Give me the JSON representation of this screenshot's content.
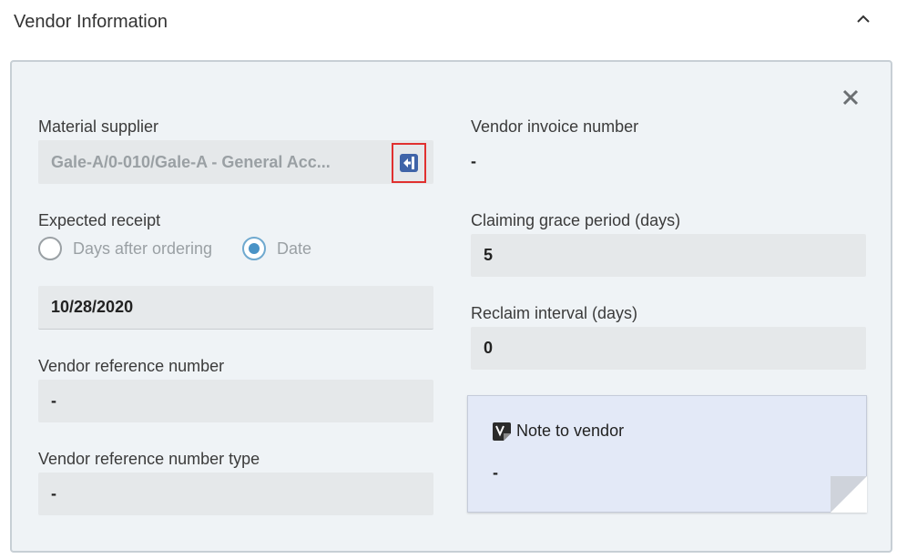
{
  "section": {
    "title": "Vendor Information"
  },
  "left": {
    "material_supplier": {
      "label": "Material supplier",
      "value": "Gale-A/0-010/Gale-A - General Acc..."
    },
    "expected_receipt": {
      "label": "Expected receipt",
      "options": [
        {
          "label": "Days after ordering",
          "selected": false
        },
        {
          "label": "Date",
          "selected": true
        }
      ],
      "date_value": "10/28/2020"
    },
    "vendor_reference_number": {
      "label": "Vendor reference number",
      "value": "-"
    },
    "vendor_reference_number_type": {
      "label": "Vendor reference number type",
      "value": "-"
    }
  },
  "right": {
    "vendor_invoice_number": {
      "label": "Vendor invoice number",
      "value": "-"
    },
    "claiming_grace_period": {
      "label": "Claiming grace period (days)",
      "value": "5"
    },
    "reclaim_interval": {
      "label": "Reclaim interval (days)",
      "value": "0"
    },
    "note_to_vendor": {
      "title": "Note to vendor",
      "value": "-"
    }
  },
  "icons": {
    "collapse": "chevron-up-icon",
    "close": "close-icon",
    "supplier_link": "navigate-to-vendor-icon",
    "note": "vendor-note-icon"
  },
  "colors": {
    "panel_bg": "#eff3f6",
    "field_bg": "#e5e8ea",
    "radio_selected": "#4a93c6",
    "highlight_border": "#e0302f",
    "note_bg": "#e3e9f7",
    "icon_blue": "#3f64a8"
  }
}
